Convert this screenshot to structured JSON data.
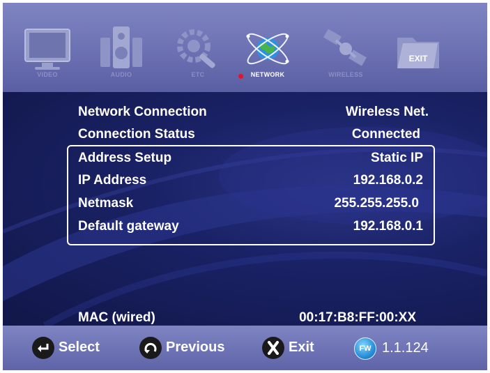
{
  "menu": {
    "items": [
      {
        "label": "VIDEO",
        "icon": "tv-icon"
      },
      {
        "label": "AUDIO",
        "icon": "speaker-icon"
      },
      {
        "label": "ETC",
        "icon": "tools-icon"
      },
      {
        "label": "NETWORK",
        "icon": "globe-network-icon",
        "active": true
      },
      {
        "label": "WIRELESS",
        "icon": "satellite-icon"
      },
      {
        "label": "EXIT",
        "icon": "exit-folder-icon"
      }
    ]
  },
  "settings": {
    "network_connection": {
      "label": "Network Connection",
      "value": "Wireless Net."
    },
    "connection_status": {
      "label": "Connection Status",
      "value": "Connected"
    },
    "address_setup": {
      "label": "Address Setup",
      "value": "Static IP"
    },
    "ip_address": {
      "label": "IP Address",
      "value": "192.168.0.2"
    },
    "netmask": {
      "label": "Netmask",
      "value": "255.255.255.0"
    },
    "default_gateway": {
      "label": "Default gateway",
      "value": "192.168.0.1"
    },
    "mac": {
      "label": "MAC (wired)",
      "value": "00:17:B8:FF:00:XX"
    }
  },
  "footer": {
    "select_label": "Select",
    "previous_label": "Previous",
    "exit_label": "Exit",
    "fw_badge": "FW",
    "fw_version": "1.1.124"
  },
  "colors": {
    "bar": "#7076b8",
    "panel": "#1a2266",
    "text": "#ffffff",
    "active_dot": "#e0162c"
  }
}
